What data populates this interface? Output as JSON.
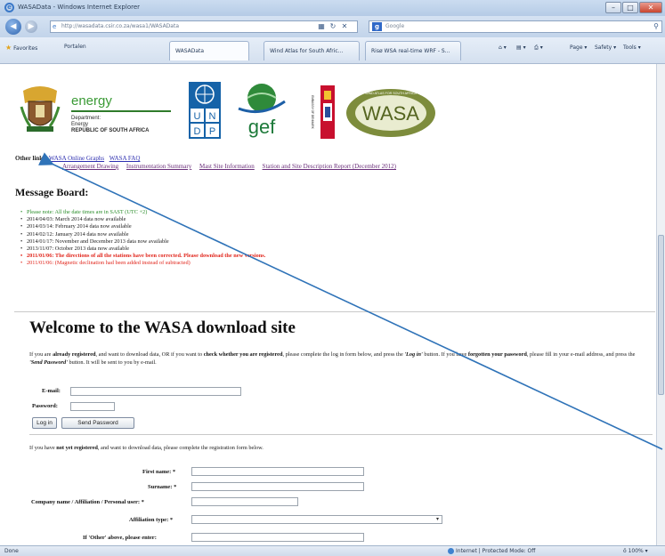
{
  "window": {
    "title": "WASAData - Windows Internet Explorer",
    "controls": [
      "–",
      "□",
      "✕"
    ]
  },
  "address": {
    "url": "http://wasadata.csir.co.za/wasa1/WASAData",
    "search_engine": "Google",
    "search_placeholder": "Google"
  },
  "favorites": {
    "favorites_label": "Favorites",
    "portalen_label": "Portalen",
    "tabs": [
      "WASAData",
      "Wind Atlas for South Afric...",
      "Risø WSA real-time WRF - S..."
    ],
    "commands": [
      "Page ▾",
      "Safety ▾",
      "Tools ▾"
    ]
  },
  "header": {
    "energy_word": "energy",
    "dept_line1": "Department:",
    "dept_line2": "Energy",
    "dept_line3": "REPUBLIC OF SOUTH AFRICA",
    "undp_letters": [
      "U",
      "N",
      "D",
      "P"
    ],
    "gef_word": "gef",
    "embassy_text": "EMBASSY OF DENMARK",
    "wasa_word": "WASA",
    "wasa_ring_text": "WIND ATLAS FOR SOUTH AFRICA"
  },
  "links": {
    "label": "Other links:",
    "row1": [
      "WASA Online Graphs",
      "WASA FAQ"
    ],
    "row2": [
      "Arrangement Drawing",
      "Instrumentation Summary",
      "Mast Site Information",
      "Station and Site Description Report (December 2012)"
    ]
  },
  "message_board": {
    "title": "Message Board:",
    "items": [
      {
        "text": "Please note: All the date times are in SAST (UTC +2)",
        "style": "green"
      },
      {
        "text": "2014/04/03: March 2014 data now available",
        "style": "normal"
      },
      {
        "text": "2014/03/14: February 2014 data now available",
        "style": "normal"
      },
      {
        "text": "2014/02/12: January 2014 data now available",
        "style": "normal"
      },
      {
        "text": "2014/01/17: November and December 2013 data now available",
        "style": "normal"
      },
      {
        "text": "2013/11/07: October 2013 data now available",
        "style": "normal"
      },
      {
        "text": "2011/01/06: The directions of all the stations have been corrected. Please download the new versions.",
        "style": "red-bold"
      },
      {
        "text": "2011/01/06: (Magnetic declination had been added instead of subtracted)",
        "style": "red"
      }
    ]
  },
  "welcome": {
    "heading": "Welcome to the WASA download site",
    "p1_a": "If you are ",
    "p1_b": "already registered",
    "p1_c": ", and want to download data, OR if you want to ",
    "p1_d": "check whether you are registered",
    "p1_e": ", please complete the log in form below, and press the ",
    "p1_f": "'Log in'",
    "p1_g": " button. If you have ",
    "p1_h": "forgotten your password",
    "p1_i": ", please fill in your e-mail address, and press the ",
    "p1_j": "'Send Password'",
    "p1_k": " button. It will be sent to you by e-mail."
  },
  "login": {
    "email_label": "E-mail:",
    "password_label": "Password:",
    "login_button": "Log in",
    "send_password_button": "Send Password"
  },
  "register": {
    "intro_a": "If you have ",
    "intro_b": "not yet registered",
    "intro_c": ", and want to download data, please complete the registration form below.",
    "first_name_label": "First name: *",
    "surname_label": "Surname: *",
    "company_label": "Company name / Affiliation / Personal user: *",
    "affiliation_label": "Affiliation type: *",
    "other_label": "If 'Other' above, please enter:"
  },
  "status": {
    "left": "Done",
    "zone": "Internet | Protected Mode: Off",
    "zoom": "ö 100%  ▾"
  },
  "colors": {
    "link": "#2d2fb0",
    "visited": "#6a2f7a",
    "notice_green": "#2a8d2a",
    "notice_red": "#e1261c",
    "annotation_arrow": "#2f73b8"
  }
}
